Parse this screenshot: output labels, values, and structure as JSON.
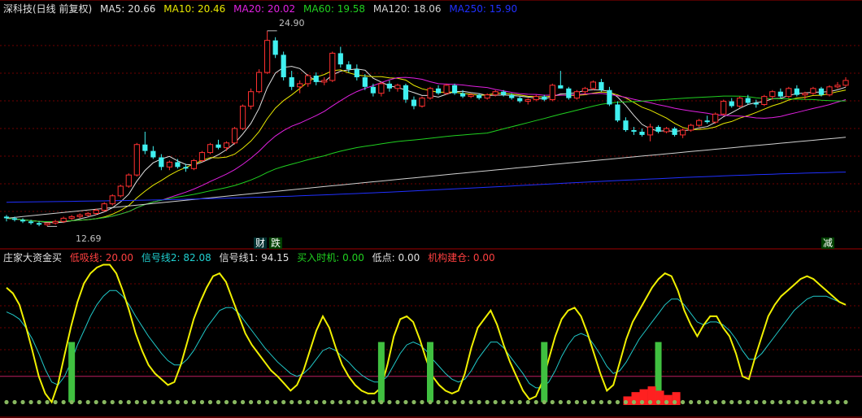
{
  "main_panel": {
    "title": "深科技(日线 前复权)",
    "ma": [
      {
        "label": "MA5: 20.66",
        "color": "#e0e0e0"
      },
      {
        "label": "MA10: 20.46",
        "color": "#e8e800"
      },
      {
        "label": "MA20: 20.02",
        "color": "#e020e0"
      },
      {
        "label": "MA60: 19.58",
        "color": "#20d020"
      },
      {
        "label": "MA120: 18.06",
        "color": "#d0d0d0"
      },
      {
        "label": "MA250: 15.90",
        "color": "#2030ff"
      }
    ],
    "high_label": "24.90",
    "low_label": "12.69",
    "event_tags": [
      {
        "text": "财",
        "color": "#ffffff",
        "bg": "#003030"
      },
      {
        "text": "跌",
        "color": "#ffffff",
        "bg": "#004000"
      },
      {
        "text": "减",
        "color": "#ffffff",
        "bg": "#004000"
      }
    ]
  },
  "indicator_panel": {
    "title": "庄家大资金买",
    "lines": [
      {
        "label": "低吸线: 20.00",
        "color": "#ff4040"
      },
      {
        "label": "信号线2: 82.08",
        "color": "#20d0d0"
      },
      {
        "label": "信号线1: 94.15",
        "color": "#e0e0e0"
      },
      {
        "label": "买入时机: 0.00",
        "color": "#20d020"
      },
      {
        "label": "低点: 0.00",
        "color": "#e0e0e0"
      },
      {
        "label": "机构建仓: 0.00",
        "color": "#ff4040"
      }
    ]
  },
  "chart_data": {
    "type": "candlestick",
    "price_range": [
      12.69,
      24.9
    ],
    "candles": [
      [
        13.3,
        13.4,
        13.0,
        13.2
      ],
      [
        13.2,
        13.3,
        13.0,
        13.1
      ],
      [
        13.1,
        13.2,
        12.9,
        13.0
      ],
      [
        13.0,
        13.1,
        12.8,
        12.9
      ],
      [
        12.9,
        13.0,
        12.7,
        12.8
      ],
      [
        12.8,
        12.9,
        12.69,
        12.9
      ],
      [
        12.9,
        13.1,
        12.8,
        13.0
      ],
      [
        13.0,
        13.3,
        12.9,
        13.2
      ],
      [
        13.2,
        13.4,
        13.1,
        13.3
      ],
      [
        13.3,
        13.5,
        13.2,
        13.4
      ],
      [
        13.4,
        13.6,
        13.3,
        13.5
      ],
      [
        13.5,
        13.8,
        13.4,
        13.7
      ],
      [
        13.7,
        14.2,
        13.6,
        14.1
      ],
      [
        14.1,
        14.7,
        14.0,
        14.6
      ],
      [
        14.6,
        15.3,
        14.5,
        15.2
      ],
      [
        15.2,
        16.0,
        15.1,
        15.9
      ],
      [
        15.9,
        17.9,
        15.8,
        17.8
      ],
      [
        17.8,
        18.6,
        17.2,
        17.4
      ],
      [
        17.4,
        17.7,
        16.9,
        17.0
      ],
      [
        17.0,
        17.2,
        16.2,
        16.4
      ],
      [
        16.4,
        16.8,
        16.2,
        16.7
      ],
      [
        16.7,
        16.9,
        16.3,
        16.4
      ],
      [
        16.4,
        16.6,
        16.1,
        16.3
      ],
      [
        16.3,
        16.9,
        16.2,
        16.8
      ],
      [
        16.8,
        17.4,
        16.7,
        17.3
      ],
      [
        17.3,
        17.9,
        17.2,
        17.8
      ],
      [
        17.8,
        18.1,
        17.5,
        17.6
      ],
      [
        17.6,
        18.0,
        17.4,
        17.9
      ],
      [
        17.9,
        18.9,
        17.8,
        18.8
      ],
      [
        18.8,
        20.3,
        18.7,
        20.2
      ],
      [
        20.2,
        21.3,
        20.0,
        21.1
      ],
      [
        21.1,
        22.5,
        21.0,
        22.3
      ],
      [
        22.3,
        24.9,
        22.2,
        24.3
      ],
      [
        24.3,
        24.5,
        23.2,
        23.4
      ],
      [
        23.4,
        23.6,
        21.8,
        22.0
      ],
      [
        22.0,
        22.4,
        21.2,
        21.4
      ],
      [
        21.4,
        21.8,
        21.0,
        21.6
      ],
      [
        21.6,
        22.2,
        21.4,
        22.1
      ],
      [
        22.1,
        22.3,
        21.5,
        21.7
      ],
      [
        21.7,
        22.0,
        21.5,
        21.8
      ],
      [
        21.8,
        23.6,
        21.7,
        23.5
      ],
      [
        23.5,
        23.9,
        22.6,
        22.8
      ],
      [
        22.8,
        23.0,
        22.3,
        22.5
      ],
      [
        22.5,
        22.8,
        21.8,
        22.0
      ],
      [
        22.0,
        22.2,
        21.2,
        21.4
      ],
      [
        21.4,
        21.6,
        20.8,
        21.0
      ],
      [
        21.0,
        21.7,
        20.8,
        21.6
      ],
      [
        21.6,
        21.8,
        21.1,
        21.3
      ],
      [
        21.3,
        21.6,
        21.1,
        21.5
      ],
      [
        21.5,
        21.6,
        20.4,
        20.6
      ],
      [
        20.6,
        20.8,
        20.0,
        20.2
      ],
      [
        20.2,
        20.8,
        20.1,
        20.7
      ],
      [
        20.7,
        21.4,
        20.6,
        21.3
      ],
      [
        21.3,
        21.5,
        20.9,
        21.0
      ],
      [
        21.0,
        21.6,
        20.9,
        21.5
      ],
      [
        21.5,
        21.6,
        20.9,
        21.0
      ],
      [
        21.0,
        21.2,
        20.7,
        20.8
      ],
      [
        20.8,
        21.0,
        20.7,
        20.9
      ],
      [
        20.9,
        21.0,
        20.6,
        20.7
      ],
      [
        20.7,
        21.0,
        20.6,
        20.9
      ],
      [
        20.9,
        21.2,
        20.8,
        21.1
      ],
      [
        21.1,
        21.2,
        20.8,
        20.9
      ],
      [
        20.9,
        21.0,
        20.6,
        20.7
      ],
      [
        20.7,
        20.8,
        20.4,
        20.5
      ],
      [
        20.5,
        20.7,
        20.3,
        20.6
      ],
      [
        20.6,
        20.9,
        20.5,
        20.8
      ],
      [
        20.8,
        20.9,
        20.5,
        20.6
      ],
      [
        20.6,
        21.6,
        20.5,
        21.5
      ],
      [
        21.5,
        22.4,
        21.3,
        21.3
      ],
      [
        21.3,
        21.4,
        20.6,
        20.7
      ],
      [
        20.7,
        21.2,
        20.6,
        21.1
      ],
      [
        21.1,
        21.4,
        20.9,
        21.3
      ],
      [
        21.3,
        21.8,
        21.2,
        21.7
      ],
      [
        21.7,
        21.9,
        21.1,
        21.2
      ],
      [
        21.2,
        21.4,
        20.2,
        20.3
      ],
      [
        20.3,
        20.5,
        19.2,
        19.3
      ],
      [
        19.3,
        19.5,
        18.6,
        18.7
      ],
      [
        18.7,
        18.9,
        18.4,
        18.6
      ],
      [
        18.6,
        18.8,
        18.3,
        18.4
      ],
      [
        18.4,
        19.1,
        18.0,
        18.9
      ],
      [
        18.9,
        19.0,
        18.5,
        18.6
      ],
      [
        18.6,
        18.9,
        18.5,
        18.8
      ],
      [
        18.8,
        18.9,
        18.3,
        18.4
      ],
      [
        18.4,
        18.8,
        18.2,
        18.7
      ],
      [
        18.7,
        19.1,
        18.6,
        19.0
      ],
      [
        19.0,
        19.4,
        18.9,
        19.3
      ],
      [
        19.3,
        19.6,
        19.1,
        19.2
      ],
      [
        19.2,
        19.8,
        19.1,
        19.7
      ],
      [
        19.7,
        20.6,
        19.6,
        20.5
      ],
      [
        20.5,
        20.7,
        20.1,
        20.2
      ],
      [
        20.2,
        20.8,
        20.1,
        20.7
      ],
      [
        20.7,
        20.9,
        20.3,
        20.4
      ],
      [
        20.4,
        20.6,
        20.1,
        20.3
      ],
      [
        20.3,
        20.9,
        20.2,
        20.8
      ],
      [
        20.8,
        21.2,
        20.6,
        21.1
      ],
      [
        21.1,
        21.3,
        20.7,
        20.8
      ],
      [
        20.8,
        21.4,
        20.7,
        21.3
      ],
      [
        21.3,
        21.5,
        20.8,
        20.9
      ],
      [
        20.9,
        21.1,
        20.6,
        21.0
      ],
      [
        21.0,
        21.4,
        20.9,
        21.3
      ],
      [
        21.3,
        21.4,
        20.8,
        20.9
      ],
      [
        20.9,
        21.5,
        20.8,
        21.4
      ],
      [
        21.4,
        21.7,
        21.3,
        21.5
      ],
      [
        21.5,
        22.0,
        21.4,
        21.8
      ]
    ],
    "indicator": {
      "range": [
        0,
        100
      ],
      "yellow": [
        82,
        78,
        70,
        55,
        38,
        20,
        8,
        2,
        15,
        35,
        55,
        72,
        85,
        92,
        96,
        98,
        98,
        92,
        80,
        66,
        50,
        38,
        28,
        22,
        18,
        14,
        16,
        28,
        44,
        60,
        72,
        82,
        90,
        92,
        86,
        74,
        62,
        50,
        42,
        36,
        30,
        24,
        20,
        15,
        10,
        14,
        24,
        38,
        52,
        62,
        54,
        40,
        28,
        20,
        14,
        10,
        8,
        8,
        12,
        28,
        48,
        60,
        62,
        58,
        46,
        32,
        20,
        14,
        10,
        8,
        10,
        22,
        40,
        54,
        60,
        66,
        56,
        42,
        30,
        20,
        10,
        4,
        6,
        16,
        32,
        48,
        60,
        66,
        68,
        62,
        50,
        36,
        22,
        10,
        14,
        30,
        46,
        58,
        66,
        74,
        82,
        88,
        92,
        90,
        80,
        66,
        56,
        48,
        56,
        62,
        62,
        54,
        48,
        36,
        20,
        18,
        34,
        48,
        62,
        70,
        76,
        80,
        84,
        88,
        90,
        88,
        84,
        80,
        76,
        72,
        70
      ],
      "cyan": [
        65,
        63,
        60,
        54,
        46,
        36,
        25,
        16,
        14,
        20,
        30,
        42,
        52,
        62,
        70,
        76,
        80,
        80,
        76,
        70,
        62,
        55,
        48,
        42,
        36,
        31,
        28,
        28,
        32,
        38,
        46,
        54,
        60,
        66,
        68,
        68,
        64,
        58,
        52,
        46,
        40,
        35,
        30,
        26,
        22,
        20,
        22,
        26,
        32,
        38,
        40,
        38,
        34,
        30,
        25,
        21,
        18,
        16,
        16,
        20,
        28,
        36,
        42,
        44,
        42,
        38,
        32,
        27,
        22,
        18,
        16,
        18,
        24,
        32,
        38,
        44,
        44,
        40,
        34,
        28,
        22,
        15,
        12,
        12,
        16,
        24,
        34,
        42,
        48,
        50,
        48,
        42,
        35,
        27,
        22,
        24,
        30,
        38,
        46,
        52,
        58,
        64,
        70,
        74,
        74,
        70,
        64,
        58,
        56,
        58,
        58,
        56,
        52,
        46,
        38,
        32,
        32,
        36,
        42,
        48,
        54,
        60,
        66,
        70,
        74,
        76,
        76,
        76,
        74,
        72,
        70
      ]
    },
    "buy_bars": [
      8,
      46,
      52,
      66,
      80
    ],
    "low_red_blocks": [
      {
        "i": 76,
        "v": 6
      },
      {
        "i": 77,
        "v": 9
      },
      {
        "i": 78,
        "v": 11
      },
      {
        "i": 79,
        "v": 13
      },
      {
        "i": 80,
        "v": 10
      },
      {
        "i": 81,
        "v": 7
      },
      {
        "i": 82,
        "v": 9
      }
    ]
  }
}
